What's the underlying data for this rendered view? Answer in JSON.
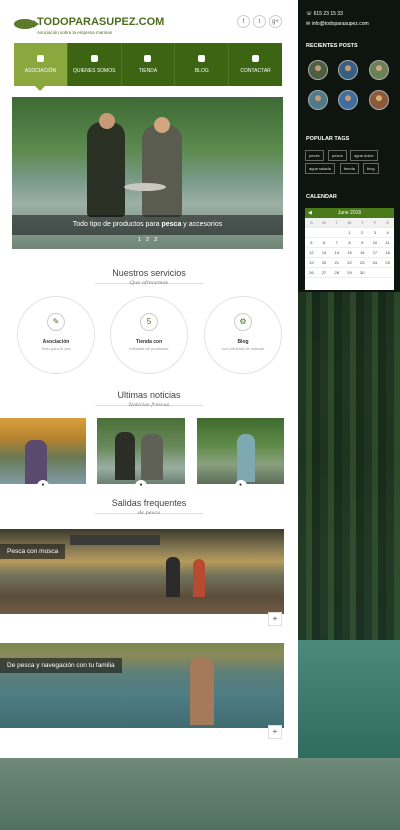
{
  "brand": {
    "name": "TODOPARASUPEZ.COM",
    "tagline": "Asociación sobre la empresa marinas"
  },
  "social": [
    "f",
    "t",
    "g+"
  ],
  "nav": [
    {
      "label": "ASOCIACIÓN",
      "icon": "home-icon"
    },
    {
      "label": "QUIENES SOMOS",
      "icon": "people-icon"
    },
    {
      "label": "TIENDA",
      "icon": "chat-icon"
    },
    {
      "label": "BLOG",
      "icon": "chat-icon"
    },
    {
      "label": "CONTACTAR",
      "icon": "mail-icon"
    }
  ],
  "hero": {
    "caption_pre": "Todo tipo de productos para ",
    "caption_bold": "pesca",
    "caption_post": " y accesorios",
    "dots": [
      "1",
      "2",
      "3"
    ]
  },
  "services": {
    "title": "Nuestros servicios",
    "subtitle": "Que ofrecemos",
    "items": [
      {
        "title": "Asociación",
        "desc": "Todo para tu pez",
        "icon": "✎"
      },
      {
        "title": "Tienda con",
        "desc": "infinidad de productos",
        "icon": "5"
      },
      {
        "title": "Blog",
        "desc": "con infinidad de noticias",
        "icon": "⚙"
      }
    ]
  },
  "news": {
    "title": "Ultimas noticias",
    "subtitle": "Noticias frescas"
  },
  "trips": {
    "title": "Salidas frequentes",
    "subtitle": "de pesca",
    "items": [
      {
        "label": "Pesca con mosca"
      },
      {
        "label": "De pesca y navegación con tu familia"
      }
    ]
  },
  "sidebar": {
    "phone": "615 23 15 33",
    "email": "info@todoparasupez.com",
    "recent_posts_title": "RECIENTES POSTS",
    "tags_title": "POPULAR TAGS",
    "tags": [
      "peces",
      "pesca",
      "agua dulce",
      "agua salada",
      "tienda",
      "blog"
    ],
    "calendar_title": "CALENDAR",
    "calendar_month": "June 2016",
    "weekdays": [
      "S",
      "M",
      "T",
      "W",
      "T",
      "F",
      "S"
    ],
    "days": [
      "",
      "",
      "",
      "1",
      "2",
      "3",
      "4",
      "5",
      "6",
      "7",
      "8",
      "9",
      "10",
      "11",
      "12",
      "13",
      "14",
      "15",
      "16",
      "17",
      "18",
      "19",
      "20",
      "21",
      "22",
      "23",
      "24",
      "25",
      "26",
      "27",
      "28",
      "29",
      "30",
      "",
      ""
    ]
  },
  "colors": {
    "brand_green": "#3c6412",
    "accent_green": "#8aa83e",
    "dark": "#0e140e"
  }
}
